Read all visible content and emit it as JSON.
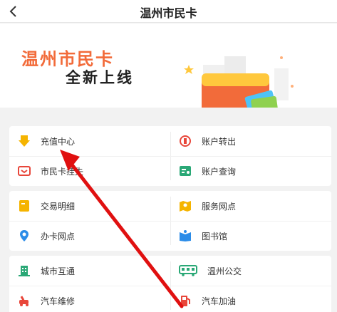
{
  "nav": {
    "title": "温州市民卡",
    "back_icon": "chevron-left-icon"
  },
  "banner": {
    "title": "温州市民卡",
    "subtitle": "全新上线"
  },
  "groups": [
    {
      "items": [
        {
          "label": "充值中心",
          "icon": "download-arrow-icon",
          "color": "#f5b400"
        },
        {
          "label": "账户转出",
          "icon": "refresh-circle-icon",
          "color": "#e8463a"
        },
        {
          "label": "市民卡挂失",
          "icon": "wallet-icon",
          "color": "#e8463a"
        },
        {
          "label": "账户查询",
          "icon": "card-search-icon",
          "color": "#2aa876"
        }
      ]
    },
    {
      "items": [
        {
          "label": "交易明细",
          "icon": "receipt-icon",
          "color": "#f5b400"
        },
        {
          "label": "服务网点",
          "icon": "map-pin-icon",
          "color": "#f5b400"
        },
        {
          "label": "办卡网点",
          "icon": "location-icon",
          "color": "#2b8ce8"
        },
        {
          "label": "图书馆",
          "icon": "book-icon",
          "color": "#2b8ce8"
        }
      ]
    },
    {
      "items": [
        {
          "label": "城市互通",
          "icon": "building-icon",
          "color": "#2aa876"
        },
        {
          "label": "温州公交",
          "icon": "bus-icon",
          "color": "#2aa876"
        },
        {
          "label": "汽车维修",
          "icon": "wrench-icon",
          "color": "#e8463a"
        },
        {
          "label": "汽车加油",
          "icon": "fuel-icon",
          "color": "#e8463a"
        }
      ]
    }
  ],
  "annotation": {
    "color": "#e01010"
  }
}
